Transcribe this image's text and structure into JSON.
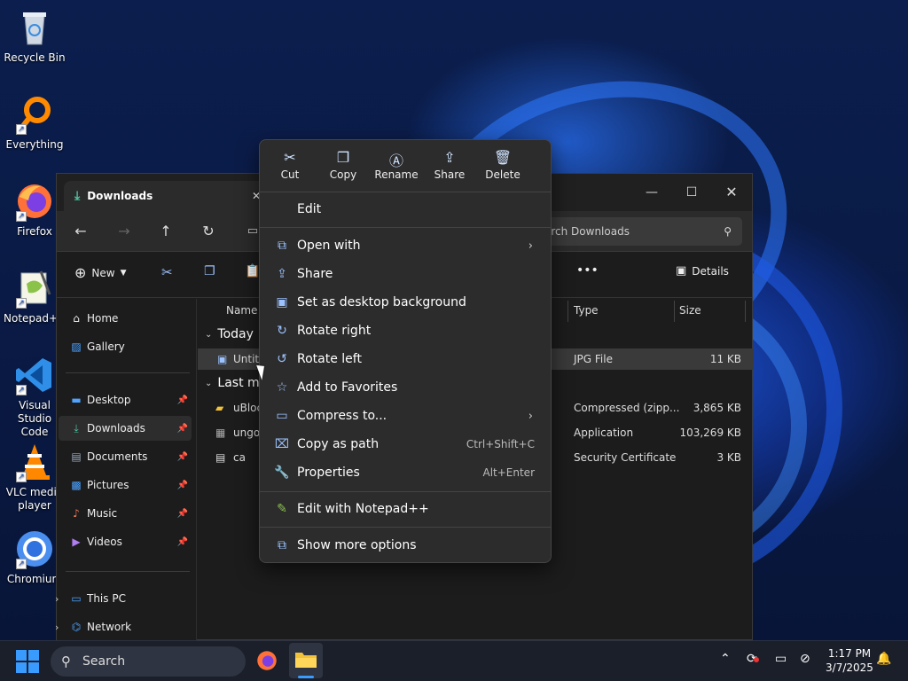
{
  "desktop": {
    "icons": [
      {
        "label": "Recycle Bin"
      },
      {
        "label": "Everything"
      },
      {
        "label": "Firefox"
      },
      {
        "label": "Notepad++"
      },
      {
        "label": "Visual Studio Code"
      },
      {
        "label": "VLC media player"
      },
      {
        "label": "Chromium"
      }
    ]
  },
  "explorer": {
    "tab_title": "Downloads",
    "tab_close": "✕",
    "search_placeholder": "Search Downloads",
    "toolbar": {
      "new_label": "New",
      "more": "•••",
      "details_label": "Details"
    },
    "nav": {
      "items": [
        {
          "label": "Home"
        },
        {
          "label": "Gallery"
        },
        {
          "label": "Desktop"
        },
        {
          "label": "Downloads"
        },
        {
          "label": "Documents"
        },
        {
          "label": "Pictures"
        },
        {
          "label": "Music"
        },
        {
          "label": "Videos"
        },
        {
          "label": "This PC"
        },
        {
          "label": "Network"
        }
      ]
    },
    "columns": {
      "name": "Name",
      "type": "Type",
      "size": "Size"
    },
    "groups": [
      {
        "label": "Today"
      },
      {
        "label": "Last mo"
      }
    ],
    "files": [
      {
        "name": "Untitl",
        "type": "JPG File",
        "size": "11 KB"
      },
      {
        "name": "uBloc",
        "type": "Compressed (zipp...",
        "size": "3,865 KB"
      },
      {
        "name": "ungoo",
        "type": "Application",
        "size": "103,269 KB"
      },
      {
        "name": "ca",
        "type": "Security Certificate",
        "size": "3 KB"
      }
    ]
  },
  "context_menu": {
    "quick_actions": [
      {
        "label": "Cut"
      },
      {
        "label": "Copy"
      },
      {
        "label": "Rename"
      },
      {
        "label": "Share"
      },
      {
        "label": "Delete"
      }
    ],
    "items": [
      {
        "label": "Edit"
      },
      {
        "label": "Open with",
        "arrow": "›"
      },
      {
        "label": "Share"
      },
      {
        "label": "Set as desktop background"
      },
      {
        "label": "Rotate right"
      },
      {
        "label": "Rotate left"
      },
      {
        "label": "Add to Favorites"
      },
      {
        "label": "Compress to...",
        "arrow": "›"
      },
      {
        "label": "Copy as path",
        "shortcut": "Ctrl+Shift+C"
      },
      {
        "label": "Properties",
        "shortcut": "Alt+Enter"
      },
      {
        "label": "Edit with Notepad++"
      },
      {
        "label": "Show more options"
      }
    ]
  },
  "taskbar": {
    "search_label": "Search",
    "time": "1:17 PM",
    "date": "3/7/2025"
  },
  "colors": {
    "accent": "#3a9bff",
    "menu_bg": "#2c2c2c",
    "window_bg": "#1c1c1c"
  }
}
